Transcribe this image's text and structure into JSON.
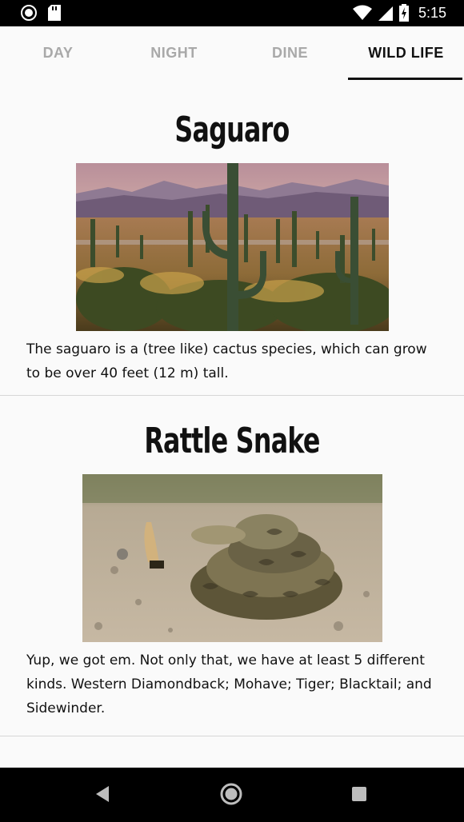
{
  "status_bar": {
    "time": "5:15",
    "icons": [
      "circle-notification-icon",
      "sd-card-icon",
      "wifi-icon",
      "signal-icon",
      "battery-charging-icon"
    ]
  },
  "tabs": [
    {
      "label": "DAY",
      "active": false
    },
    {
      "label": "NIGHT",
      "active": false
    },
    {
      "label": "DINE",
      "active": false
    },
    {
      "label": "WILD LIFE",
      "active": true
    }
  ],
  "cards": [
    {
      "title": "Saguaro",
      "image": "saguaro-cactus-desert-photo",
      "description": "The saguaro is a (tree like) cactus species, which can grow to be over 40 feet (12 m) tall."
    },
    {
      "title": "Rattle Snake",
      "image": "coiled-rattlesnake-photo",
      "description": "Yup, we got em. Not only that, we have at least 5 different kinds. Western Diamondback; Mohave; Tiger; Blacktail; and Sidewinder."
    },
    {
      "title": "",
      "image": "",
      "description": ""
    }
  ],
  "nav_bar": {
    "icons": [
      "back-icon",
      "home-icon",
      "recents-icon"
    ]
  },
  "colors": {
    "status_bar": "#000000",
    "tab_active": "#111111",
    "tab_inactive": "#a9a9a9",
    "background": "#fafafa",
    "divider": "#d6d6d6"
  }
}
